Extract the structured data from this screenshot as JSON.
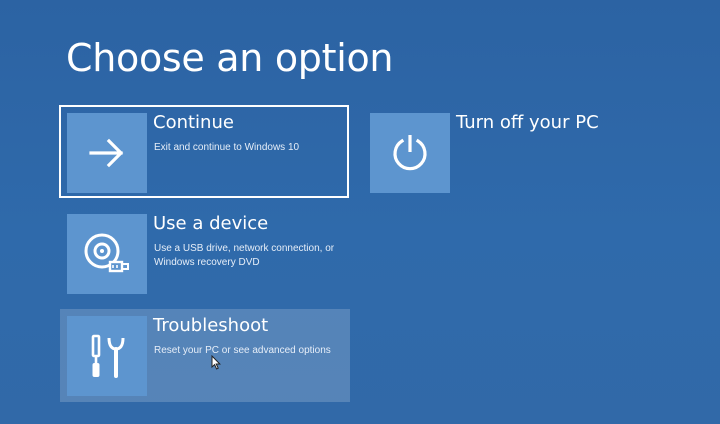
{
  "header": {
    "title": "Choose an option"
  },
  "options": [
    {
      "id": "continue",
      "title": "Continue",
      "description": "Exit and continue to Windows 10",
      "icon": "arrow-right-icon"
    },
    {
      "id": "use-device",
      "title": "Use a device",
      "description": "Use a USB drive, network connection, or Windows recovery DVD",
      "icon": "disc-usb-icon"
    },
    {
      "id": "troubleshoot",
      "title": "Troubleshoot",
      "description": "Reset your PC or see advanced options",
      "icon": "tools-icon"
    },
    {
      "id": "turn-off",
      "title": "Turn off your PC",
      "description": "",
      "icon": "power-icon"
    }
  ],
  "colors": {
    "background": "#2d66a8",
    "tile": "#5d95cf",
    "text": "#ffffff",
    "selection_border": "#ffffff"
  }
}
